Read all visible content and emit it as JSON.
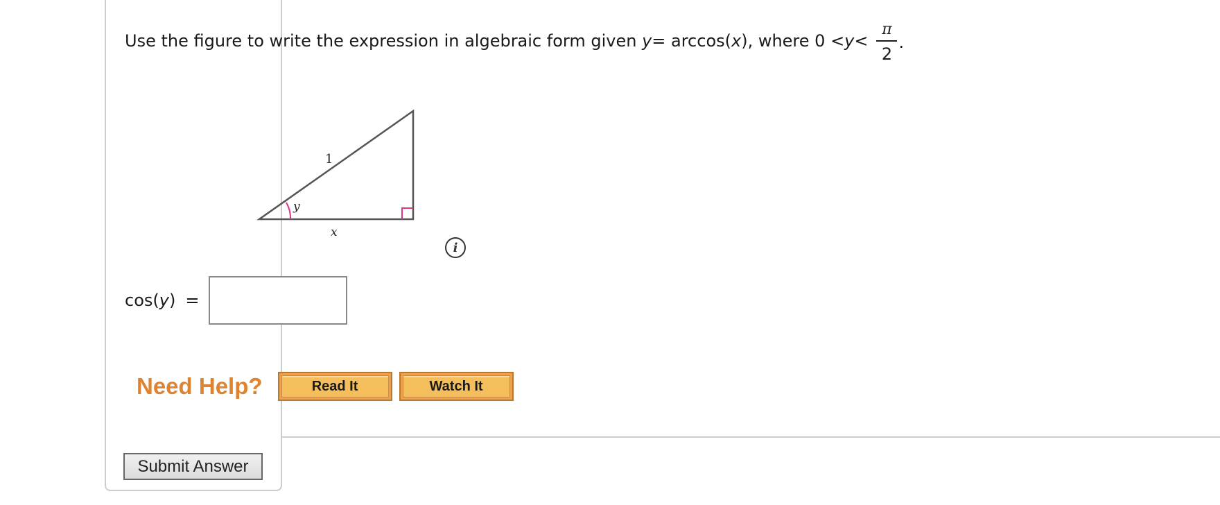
{
  "question": {
    "prefix": "Use the figure to write the expression in algebraic form given ",
    "var_y": "y",
    "equals_arccos": " = arccos(",
    "var_x": "x",
    "where": "), where 0 < ",
    "var_y2": "y",
    "less_than": " <",
    "fraction_numerator": "π",
    "fraction_denominator": "2",
    "period": "."
  },
  "figure": {
    "hypotenuse_label": "1",
    "angle_label": "y",
    "adjacent_label": "x",
    "line_color": "#555555",
    "accent_color": "#e0338a"
  },
  "info_icon": {
    "glyph": "i"
  },
  "answer": {
    "label_func": "cos(",
    "label_var": "y",
    "label_close": ")",
    "equals": "=",
    "value": "",
    "placeholder": ""
  },
  "help": {
    "title": "Need Help?",
    "title_color": "#e0832e",
    "buttons": [
      {
        "label": "Read It"
      },
      {
        "label": "Watch It"
      }
    ]
  },
  "submit": {
    "label": "Submit Answer"
  }
}
